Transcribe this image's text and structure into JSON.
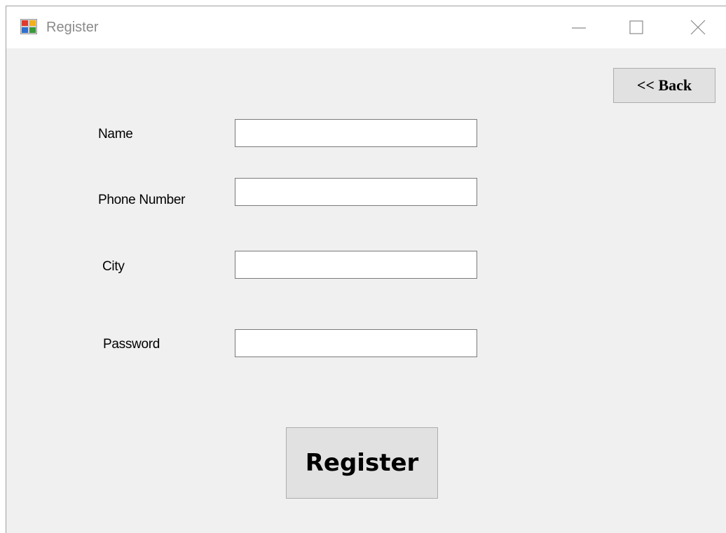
{
  "window": {
    "title": "Register",
    "icon": "form-app-icon",
    "controls": {
      "minimize_icon": "minimize-icon",
      "maximize_icon": "maximize-icon",
      "close_icon": "close-icon"
    }
  },
  "back_button": {
    "label": "<< Back"
  },
  "form": {
    "name": {
      "label": "Name",
      "value": ""
    },
    "phone": {
      "label": "Phone Number",
      "value": ""
    },
    "city": {
      "label": "City",
      "value": ""
    },
    "password": {
      "label": "Password",
      "value": ""
    }
  },
  "register_button": {
    "label": "Register"
  },
  "colors": {
    "background": "#f0f0f0",
    "titlebar": "#ffffff",
    "button_face": "#e1e1e1",
    "button_border": "#adadad",
    "input_border": "#7a7a7a"
  }
}
